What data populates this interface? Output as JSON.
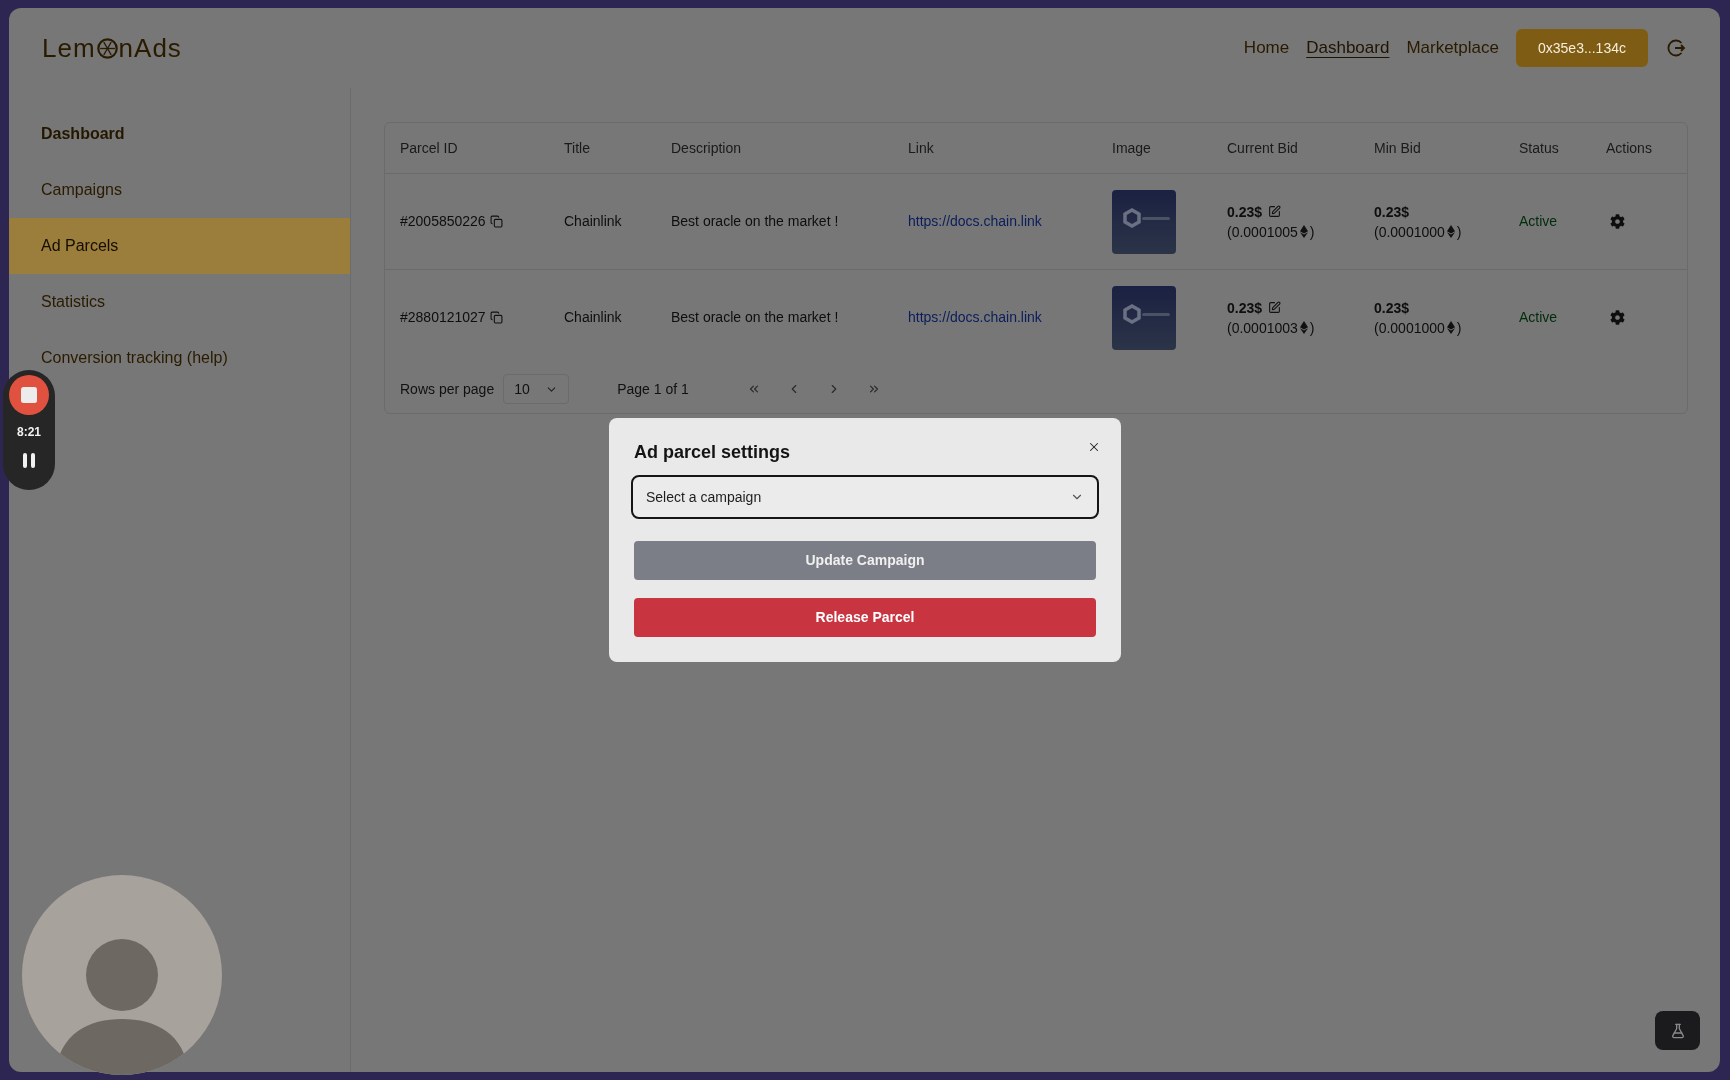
{
  "logo": {
    "text_before": "Lem",
    "text_after": "nAds"
  },
  "nav": [
    {
      "label": "Home",
      "selected": false
    },
    {
      "label": "Dashboard",
      "selected": true
    },
    {
      "label": "Marketplace",
      "selected": false
    }
  ],
  "wallet_button": {
    "label": "0x35e3...134c"
  },
  "sidebar": {
    "heading": "Dashboard",
    "items": [
      {
        "label": "Campaigns",
        "selected": false
      },
      {
        "label": "Ad Parcels",
        "selected": true
      },
      {
        "label": "Statistics",
        "selected": false
      },
      {
        "label": "Conversion tracking (help)",
        "selected": false
      }
    ]
  },
  "table": {
    "columns": [
      "Parcel ID",
      "Title",
      "Description",
      "Link",
      "Image",
      "Current Bid",
      "Min Bid",
      "Status",
      "Actions"
    ],
    "rows": [
      {
        "parcel_id": "#2005850226",
        "title": "Chainlink",
        "description": "Best oracle on the market !",
        "link": "https://docs.chain.link",
        "current_bid": {
          "usd": "0.23$",
          "eth": "(0.0001005",
          "close": ")"
        },
        "min_bid": {
          "usd": "0.23$",
          "eth": "(0.0001000",
          "close": ")"
        },
        "status": "Active"
      },
      {
        "parcel_id": "#2880121027",
        "title": "Chainlink",
        "description": "Best oracle on the market !",
        "link": "https://docs.chain.link",
        "current_bid": {
          "usd": "0.23$",
          "eth": "(0.0001003",
          "close": ")"
        },
        "min_bid": {
          "usd": "0.23$",
          "eth": "(0.0001000",
          "close": ")"
        },
        "status": "Active"
      }
    ],
    "footer": {
      "rows_per_page_label": "Rows per page",
      "rows_per_page": "10",
      "page_label": "Page 1 of 1"
    }
  },
  "dialog": {
    "title": "Ad parcel settings",
    "select": {
      "placeholder": "Select a campaign",
      "focused": true
    },
    "buttons": [
      {
        "label": "Update Campaign",
        "kind": "secondary"
      },
      {
        "label": "Release Parcel",
        "kind": "danger"
      }
    ]
  },
  "recorder": {
    "time": "8:21"
  }
}
